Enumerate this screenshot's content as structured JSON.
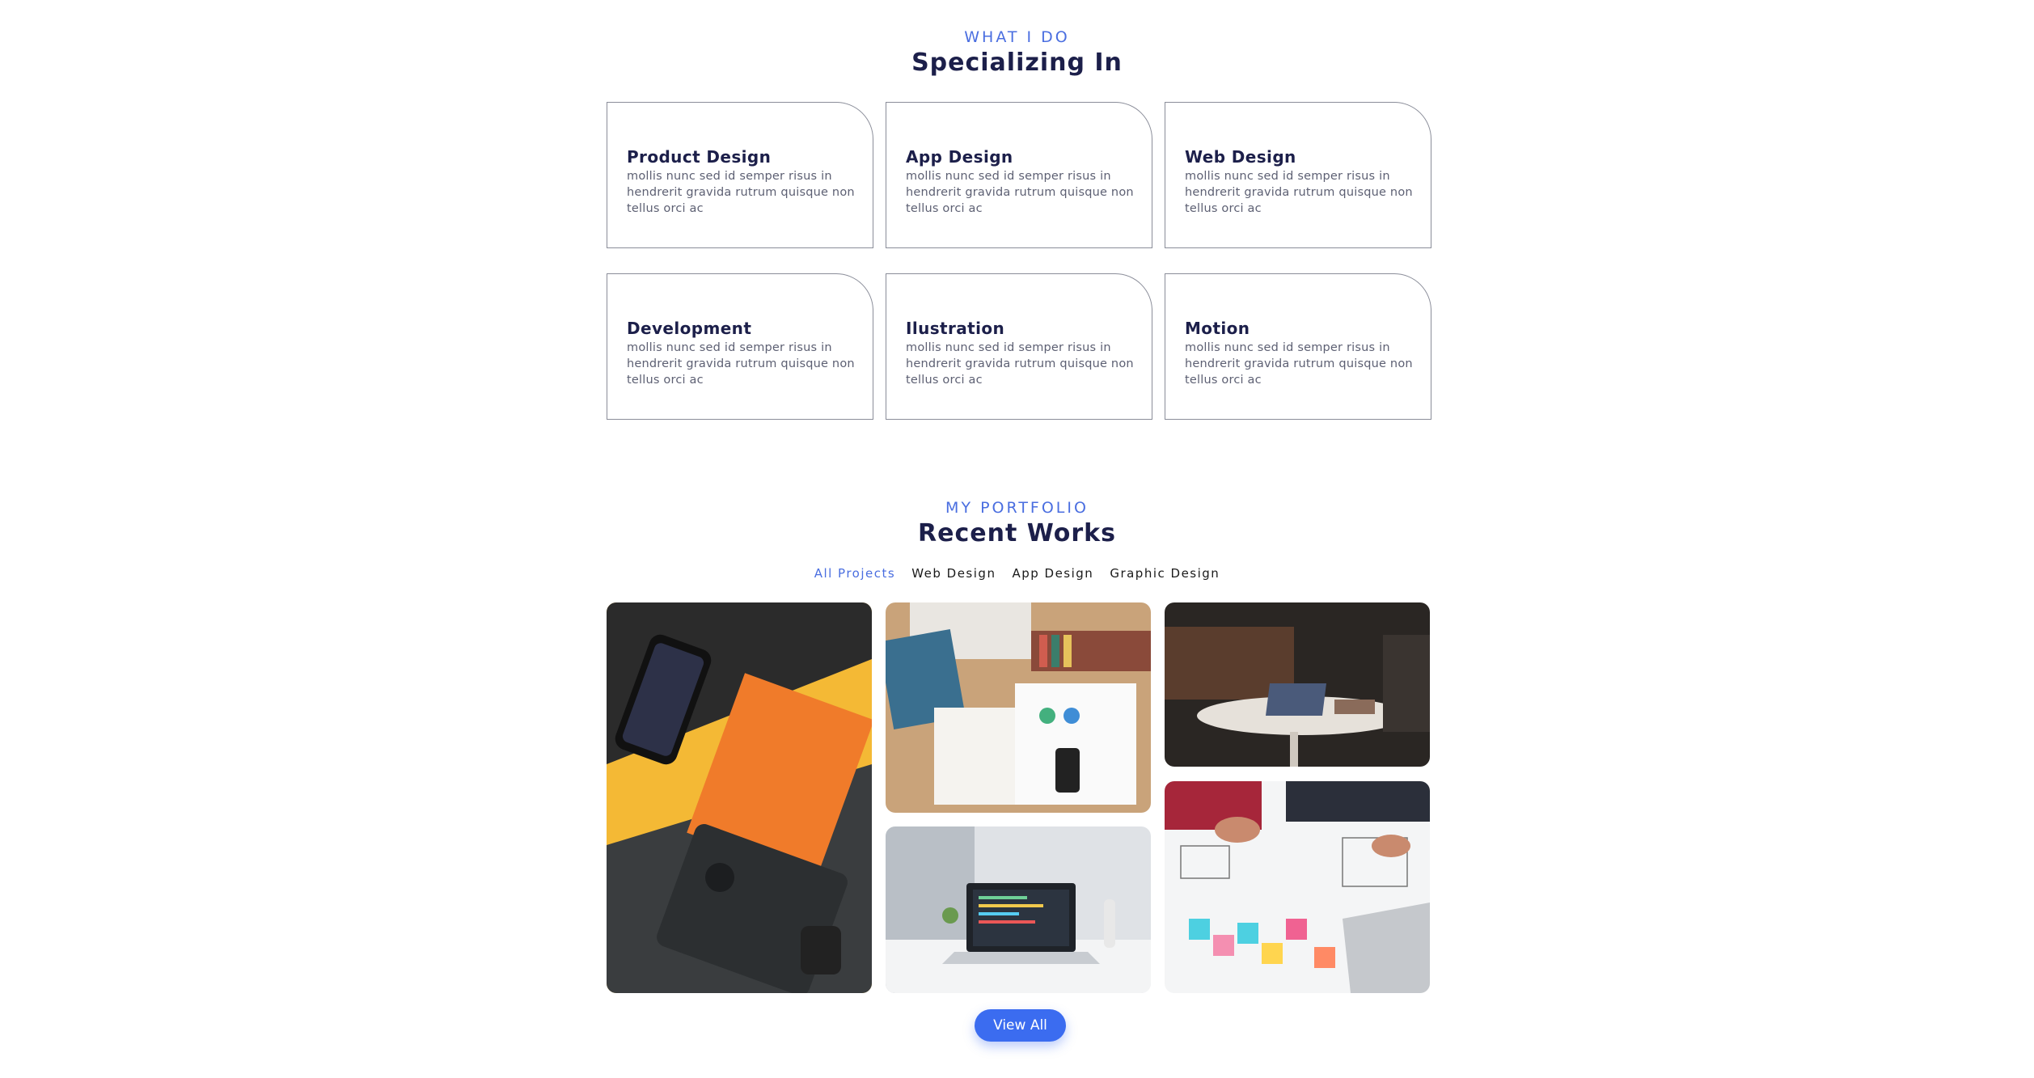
{
  "services": {
    "eyebrow": "WHAT I DO",
    "heading": "Specializing In",
    "cards": [
      {
        "title": "Product Design",
        "description": "mollis nunc sed id semper risus in hendrerit gravida rutrum quisque non tellus orci ac"
      },
      {
        "title": "App Design",
        "description": "mollis nunc sed id semper risus in hendrerit gravida rutrum quisque non tellus orci ac"
      },
      {
        "title": "Web Design",
        "description": "mollis nunc sed id semper risus in hendrerit gravida rutrum quisque non tellus orci ac"
      },
      {
        "title": "Development",
        "description": "mollis nunc sed id semper risus in hendrerit gravida rutrum quisque non tellus orci ac"
      },
      {
        "title": "Ilustration",
        "description": "mollis nunc sed id semper risus in hendrerit gravida rutrum quisque non tellus orci ac"
      },
      {
        "title": "Motion",
        "description": "mollis nunc sed id semper risus in hendrerit gravida rutrum quisque non tellus orci ac"
      }
    ]
  },
  "portfolio": {
    "eyebrow": "MY PORTFOLIO",
    "heading": "Recent Works",
    "filters": [
      {
        "label": "All Projects",
        "active": true
      },
      {
        "label": "Web Design",
        "active": false
      },
      {
        "label": "App Design",
        "active": false
      },
      {
        "label": "Graphic Design",
        "active": false
      }
    ],
    "tiles": [
      {
        "name": "change-by-design-book-photo"
      },
      {
        "name": "desk-flatlay-photo"
      },
      {
        "name": "laptop-cafe-photo"
      },
      {
        "name": "laptop-desk-code-photo"
      },
      {
        "name": "wireframe-sketch-photo"
      }
    ],
    "view_all_label": "View All",
    "accent_color": "#4a6ee0",
    "button_color": "#3b6cf0"
  }
}
